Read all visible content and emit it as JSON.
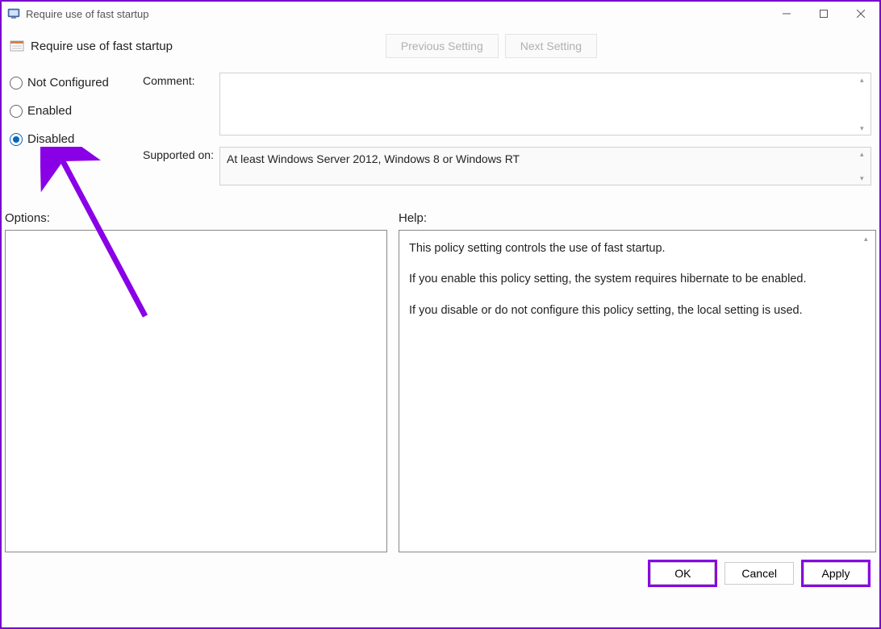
{
  "window": {
    "title": "Require use of fast startup"
  },
  "header": {
    "policy_title": "Require use of fast startup",
    "prev_label": "Previous Setting",
    "next_label": "Next Setting"
  },
  "radios": {
    "not_configured": "Not Configured",
    "enabled": "Enabled",
    "disabled": "Disabled",
    "selected": "disabled"
  },
  "fields": {
    "comment_label": "Comment:",
    "comment_value": "",
    "supported_label": "Supported on:",
    "supported_value": "At least Windows Server 2012, Windows 8 or Windows RT"
  },
  "sections": {
    "options_label": "Options:",
    "help_label": "Help:"
  },
  "help": {
    "p1": "This policy setting controls the use of fast startup.",
    "p2": "If you enable this policy setting, the system requires hibernate to be enabled.",
    "p3": "If you disable or do not configure this policy setting, the local setting is used."
  },
  "footer": {
    "ok": "OK",
    "cancel": "Cancel",
    "apply": "Apply"
  }
}
